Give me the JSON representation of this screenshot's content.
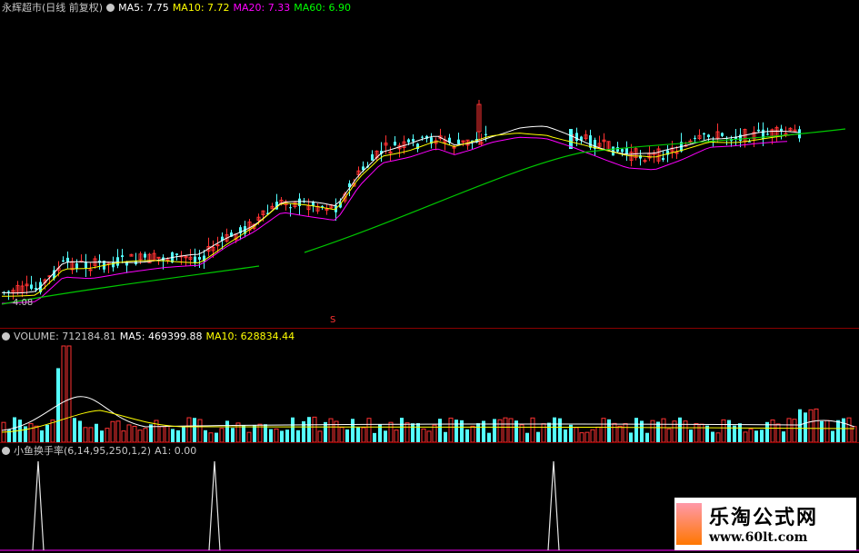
{
  "price": {
    "stock_name": "永辉超市(日线 前复权)",
    "ma5_label": "MA5: 7.75",
    "ma10_label": "MA10: 7.72",
    "ma20_label": "MA20: 7.33",
    "ma60_label": "MA60: 6.90",
    "low_marker": "4.08",
    "mid_marker": "S"
  },
  "volume": {
    "title": "VOLUME: 712184.81",
    "ma5_label": "MA5: 469399.88",
    "ma10_label": "MA10: 628834.44"
  },
  "indicator": {
    "title": "小鱼换手率(6,14,95,250,1,2)",
    "a1_label": "A1: 0.00"
  },
  "watermark": {
    "title": "乐淘公式网",
    "url": "www.60lt.com"
  },
  "colors": {
    "up": "#ff3232",
    "down": "#54ffff",
    "ma5": "#ffffff",
    "ma10": "#ffff00",
    "ma20": "#ff00ff",
    "ma60": "#00c800",
    "header_text": "#c8c8c8"
  },
  "chart_data": [
    {
      "type": "candlestick",
      "title": "永辉超市(日线 前复权)",
      "series": [
        {
          "name": "MA5",
          "values": [
            7.75
          ]
        },
        {
          "name": "MA10",
          "values": [
            7.72
          ]
        },
        {
          "name": "MA20",
          "values": [
            7.33
          ]
        },
        {
          "name": "MA60",
          "values": [
            6.9
          ]
        }
      ],
      "annotations": [
        "4.08",
        "S"
      ]
    },
    {
      "type": "bar",
      "title": "VOLUME: 712184.81",
      "series": [
        {
          "name": "MA5",
          "values": [
            469399.88
          ]
        },
        {
          "name": "MA10",
          "values": [
            628834.44
          ]
        }
      ]
    },
    {
      "type": "line",
      "title": "小鱼换手率(6,14,95,250,1,2)",
      "series": [
        {
          "name": "A1",
          "values": [
            0.0
          ]
        }
      ]
    }
  ]
}
